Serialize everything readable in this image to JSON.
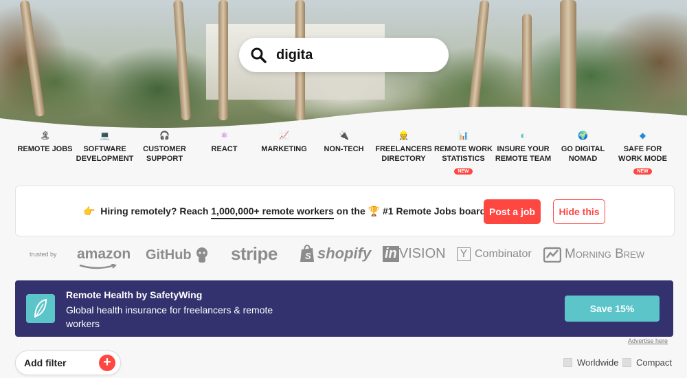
{
  "hero": {
    "tagline": ""
  },
  "search": {
    "value": "digita"
  },
  "categories": [
    {
      "icon": "🏝",
      "icon_name": "island-icon",
      "line1": "REMOTE JOBS",
      "line2": "",
      "badge": ""
    },
    {
      "icon": "💻",
      "icon_name": "laptop-icon",
      "line1": "SOFTWARE",
      "line2": "DEVELOPMENT",
      "badge": ""
    },
    {
      "icon": "🎧",
      "icon_name": "headphones-icon",
      "line1": "CUSTOMER",
      "line2": "SUPPORT",
      "badge": ""
    },
    {
      "icon": "⚛",
      "icon_name": "react-icon",
      "line1": "REACT",
      "line2": "",
      "badge": ""
    },
    {
      "icon": "📈",
      "icon_name": "chart-icon",
      "line1": "MARKETING",
      "line2": "",
      "badge": ""
    },
    {
      "icon": "🔌",
      "icon_name": "plug-icon",
      "line1": "NON-TECH",
      "line2": "",
      "badge": ""
    },
    {
      "icon": "👷",
      "icon_name": "worker-icon",
      "line1": "FREELANCERS",
      "line2": "DIRECTORY",
      "badge": ""
    },
    {
      "icon": "📊",
      "icon_name": "bar-chart-icon",
      "line1": "REMOTE WORK",
      "line2": "STATISTICS",
      "badge": "NEW"
    },
    {
      "icon": "◐",
      "icon_name": "insurance-icon",
      "line1": "INSURE YOUR",
      "line2": "REMOTE TEAM",
      "badge": ""
    },
    {
      "icon": "🌍",
      "icon_name": "globe-icon",
      "line1": "GO DIGITAL",
      "line2": "NOMAD",
      "badge": ""
    },
    {
      "icon": "◆",
      "icon_name": "vscode-icon",
      "line1": "SAFE FOR",
      "line2": "WORK MODE",
      "badge": "NEW"
    }
  ],
  "hiring": {
    "hand": "👉",
    "text_before": "Hiring remotely? Reach ",
    "highlight": "1,000,000+ remote workers",
    "text_mid": " on the ",
    "trophy": "🏆",
    "text_after": " #1 Remote Jobs board",
    "post_label": "Post a job",
    "hide_label": "Hide this"
  },
  "trusted": {
    "label": "trusted by",
    "logos": [
      "amazon",
      "GitHub",
      "stripe",
      "shopify",
      "invision",
      "Combinator",
      "Morning Brew"
    ],
    "yc_mark": "Y",
    "invision_in": "in",
    "invision_rest": "VISION"
  },
  "safetywing": {
    "title": "Remote Health by SafetyWing",
    "subtitle": "Global health insurance for freelancers & remote workers",
    "cta": "Save 15%",
    "advertise": "Advertise here"
  },
  "filters": {
    "add_label": "Add filter",
    "plus": "+",
    "worldwide": "Worldwide",
    "compact": "Compact"
  },
  "colors": {
    "accent": "#ff4742",
    "sw_bg": "#33316e",
    "sw_teal": "#5cc5c9"
  }
}
